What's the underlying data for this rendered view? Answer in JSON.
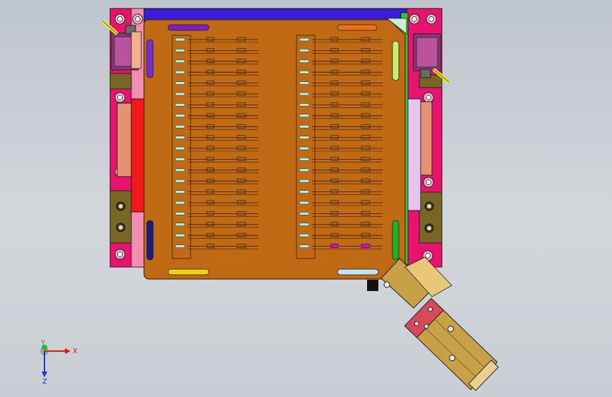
{
  "viewport": {
    "background_top": "#bfc5cc",
    "background_bottom": "#c9ced4"
  },
  "colors": {
    "frame_pink": "#e8136e",
    "plate_orange": "#c06a16",
    "plate_stroke": "#4a2a08",
    "fixture_top_bar": "#3a1cd6",
    "side_red": "#f01818",
    "side_salmon": "#e89072",
    "side_lavender": "#e6c4f0",
    "block_olive": "#7a6624",
    "motor_purple": "#8a3a78",
    "cylinder_gold": "#c8a048",
    "slot_purple": "#8020c0",
    "slot_orange": "#f07018",
    "slot_yellow": "#f5d012",
    "slot_lightblue": "#bfe4f4",
    "slot_navy": "#1a1a80",
    "slot_lime": "#c8f068",
    "slot_green": "#20b020",
    "pin_mint": "#aef0d8",
    "accent_magenta": "#e000e0"
  },
  "triad": {
    "x_label": "X",
    "y_label": "Y",
    "z_label": "Z",
    "x_color": "#e01818",
    "y_color": "#20c020",
    "z_color": "#2030e0"
  },
  "icons": {
    "triad": "coordinate-triad-icon"
  },
  "pin_rows_per_column": 20
}
